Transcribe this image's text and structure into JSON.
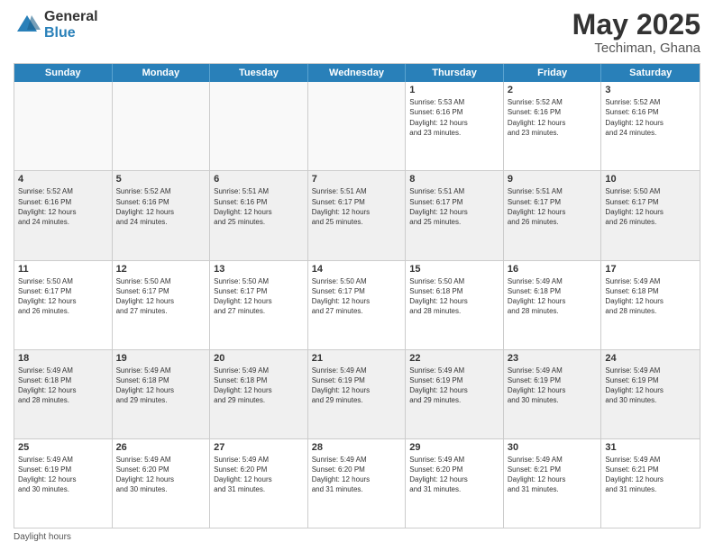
{
  "header": {
    "logo_general": "General",
    "logo_blue": "Blue",
    "title": "May 2025",
    "subtitle": "Techiman, Ghana"
  },
  "days_of_week": [
    "Sunday",
    "Monday",
    "Tuesday",
    "Wednesday",
    "Thursday",
    "Friday",
    "Saturday"
  ],
  "weeks": [
    [
      {
        "day": "",
        "info": ""
      },
      {
        "day": "",
        "info": ""
      },
      {
        "day": "",
        "info": ""
      },
      {
        "day": "",
        "info": ""
      },
      {
        "day": "1",
        "info": "Sunrise: 5:53 AM\nSunset: 6:16 PM\nDaylight: 12 hours\nand 23 minutes."
      },
      {
        "day": "2",
        "info": "Sunrise: 5:52 AM\nSunset: 6:16 PM\nDaylight: 12 hours\nand 23 minutes."
      },
      {
        "day": "3",
        "info": "Sunrise: 5:52 AM\nSunset: 6:16 PM\nDaylight: 12 hours\nand 24 minutes."
      }
    ],
    [
      {
        "day": "4",
        "info": "Sunrise: 5:52 AM\nSunset: 6:16 PM\nDaylight: 12 hours\nand 24 minutes."
      },
      {
        "day": "5",
        "info": "Sunrise: 5:52 AM\nSunset: 6:16 PM\nDaylight: 12 hours\nand 24 minutes."
      },
      {
        "day": "6",
        "info": "Sunrise: 5:51 AM\nSunset: 6:16 PM\nDaylight: 12 hours\nand 25 minutes."
      },
      {
        "day": "7",
        "info": "Sunrise: 5:51 AM\nSunset: 6:17 PM\nDaylight: 12 hours\nand 25 minutes."
      },
      {
        "day": "8",
        "info": "Sunrise: 5:51 AM\nSunset: 6:17 PM\nDaylight: 12 hours\nand 25 minutes."
      },
      {
        "day": "9",
        "info": "Sunrise: 5:51 AM\nSunset: 6:17 PM\nDaylight: 12 hours\nand 26 minutes."
      },
      {
        "day": "10",
        "info": "Sunrise: 5:50 AM\nSunset: 6:17 PM\nDaylight: 12 hours\nand 26 minutes."
      }
    ],
    [
      {
        "day": "11",
        "info": "Sunrise: 5:50 AM\nSunset: 6:17 PM\nDaylight: 12 hours\nand 26 minutes."
      },
      {
        "day": "12",
        "info": "Sunrise: 5:50 AM\nSunset: 6:17 PM\nDaylight: 12 hours\nand 27 minutes."
      },
      {
        "day": "13",
        "info": "Sunrise: 5:50 AM\nSunset: 6:17 PM\nDaylight: 12 hours\nand 27 minutes."
      },
      {
        "day": "14",
        "info": "Sunrise: 5:50 AM\nSunset: 6:17 PM\nDaylight: 12 hours\nand 27 minutes."
      },
      {
        "day": "15",
        "info": "Sunrise: 5:50 AM\nSunset: 6:18 PM\nDaylight: 12 hours\nand 28 minutes."
      },
      {
        "day": "16",
        "info": "Sunrise: 5:49 AM\nSunset: 6:18 PM\nDaylight: 12 hours\nand 28 minutes."
      },
      {
        "day": "17",
        "info": "Sunrise: 5:49 AM\nSunset: 6:18 PM\nDaylight: 12 hours\nand 28 minutes."
      }
    ],
    [
      {
        "day": "18",
        "info": "Sunrise: 5:49 AM\nSunset: 6:18 PM\nDaylight: 12 hours\nand 28 minutes."
      },
      {
        "day": "19",
        "info": "Sunrise: 5:49 AM\nSunset: 6:18 PM\nDaylight: 12 hours\nand 29 minutes."
      },
      {
        "day": "20",
        "info": "Sunrise: 5:49 AM\nSunset: 6:18 PM\nDaylight: 12 hours\nand 29 minutes."
      },
      {
        "day": "21",
        "info": "Sunrise: 5:49 AM\nSunset: 6:19 PM\nDaylight: 12 hours\nand 29 minutes."
      },
      {
        "day": "22",
        "info": "Sunrise: 5:49 AM\nSunset: 6:19 PM\nDaylight: 12 hours\nand 29 minutes."
      },
      {
        "day": "23",
        "info": "Sunrise: 5:49 AM\nSunset: 6:19 PM\nDaylight: 12 hours\nand 30 minutes."
      },
      {
        "day": "24",
        "info": "Sunrise: 5:49 AM\nSunset: 6:19 PM\nDaylight: 12 hours\nand 30 minutes."
      }
    ],
    [
      {
        "day": "25",
        "info": "Sunrise: 5:49 AM\nSunset: 6:19 PM\nDaylight: 12 hours\nand 30 minutes."
      },
      {
        "day": "26",
        "info": "Sunrise: 5:49 AM\nSunset: 6:20 PM\nDaylight: 12 hours\nand 30 minutes."
      },
      {
        "day": "27",
        "info": "Sunrise: 5:49 AM\nSunset: 6:20 PM\nDaylight: 12 hours\nand 31 minutes."
      },
      {
        "day": "28",
        "info": "Sunrise: 5:49 AM\nSunset: 6:20 PM\nDaylight: 12 hours\nand 31 minutes."
      },
      {
        "day": "29",
        "info": "Sunrise: 5:49 AM\nSunset: 6:20 PM\nDaylight: 12 hours\nand 31 minutes."
      },
      {
        "day": "30",
        "info": "Sunrise: 5:49 AM\nSunset: 6:21 PM\nDaylight: 12 hours\nand 31 minutes."
      },
      {
        "day": "31",
        "info": "Sunrise: 5:49 AM\nSunset: 6:21 PM\nDaylight: 12 hours\nand 31 minutes."
      }
    ]
  ],
  "footer": {
    "note": "Daylight hours"
  },
  "colors": {
    "header_bg": "#2980b9",
    "alt_row": "#f0f0f0"
  }
}
